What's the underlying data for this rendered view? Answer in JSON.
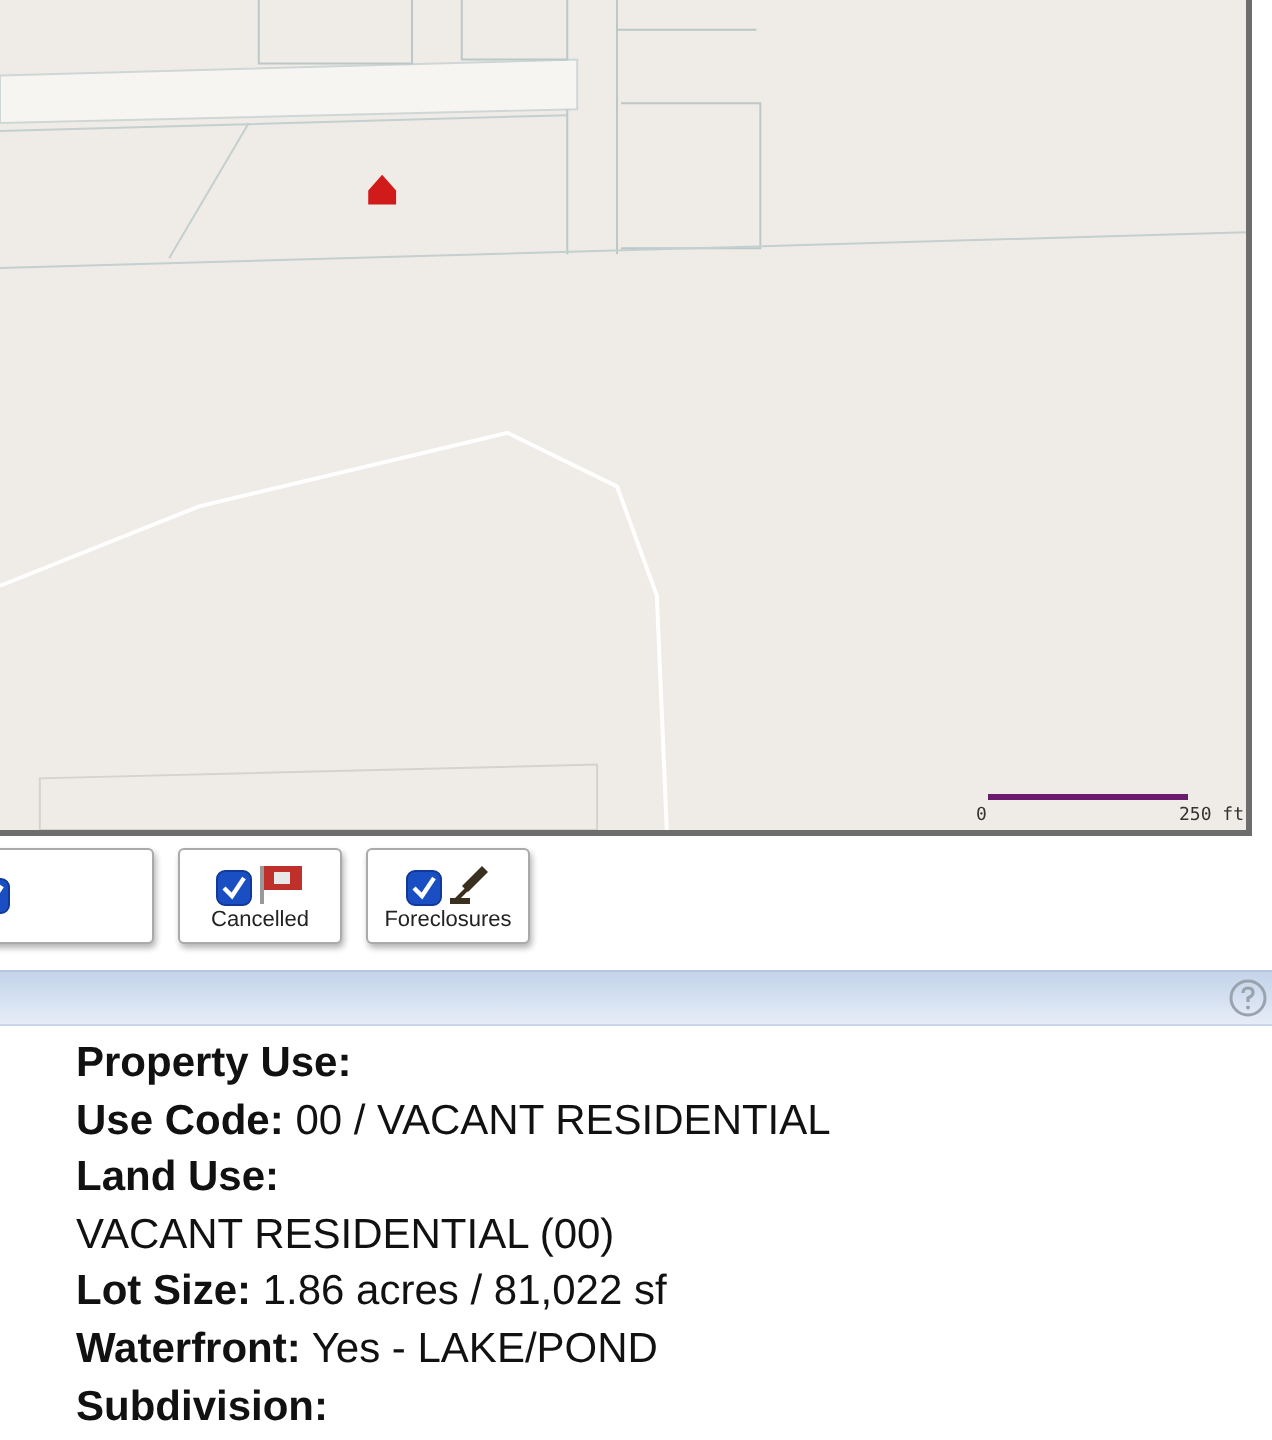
{
  "map": {
    "scale": {
      "start": "0",
      "end": "250 ft"
    }
  },
  "filters": [
    {
      "checked": true
    },
    {
      "label": "Cancelled",
      "checked": true
    },
    {
      "label": "Foreclosures",
      "checked": true
    }
  ],
  "details": [
    "**Property Use:**",
    "**Use Code:** 00 / VACANT RESIDENTIAL",
    "**Land Use:**",
    "VACANT RESIDENTIAL (00)",
    "**Lot Size:** 1.86 acres / 81,022 sf",
    "**Waterfront:** Yes - LAKE/POND",
    "**Subdivision:**"
  ]
}
